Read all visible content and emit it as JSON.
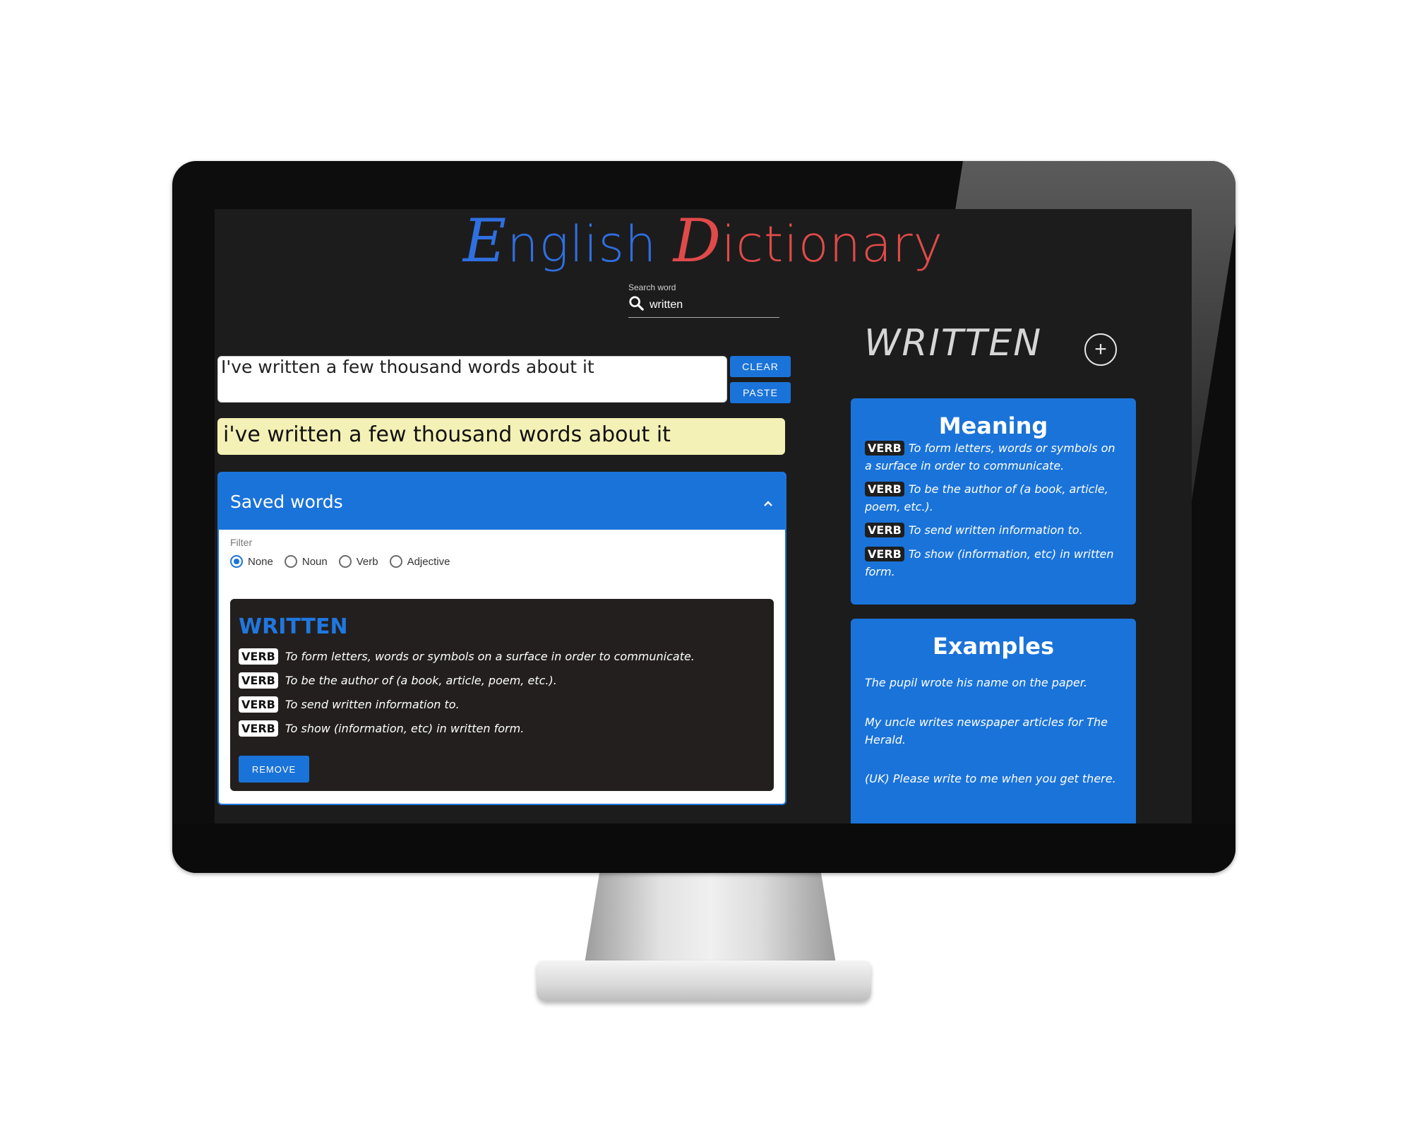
{
  "app": {
    "title_part1_initial": "E",
    "title_part1_rest": "nglish ",
    "title_part2_initial": "D",
    "title_part2_rest": "ictionary",
    "accent_blue": "#1a73d9",
    "accent_red": "#e04a4a"
  },
  "search": {
    "label": "Search word",
    "value": "written",
    "icon": "search-icon"
  },
  "sentence": {
    "value": "I've written a few thousand words about it",
    "clear_label": "CLEAR",
    "paste_label": "PASTE"
  },
  "output": {
    "text": "i've written a few thousand words about it"
  },
  "saved": {
    "header": "Saved words",
    "expand_icon": "chevron-up-icon",
    "filter_label": "Filter",
    "filters": [
      "None",
      "Noun",
      "Verb",
      "Adjective"
    ],
    "selected_filter": "None",
    "card": {
      "word": "WRITTEN",
      "definitions": [
        {
          "pos": "VERB",
          "text": "To form letters, words or symbols on a surface in order to communicate."
        },
        {
          "pos": "VERB",
          "text": "To be the author of (a book, article, poem, etc.)."
        },
        {
          "pos": "VERB",
          "text": "To send written information to."
        },
        {
          "pos": "VERB",
          "text": "To show (information, etc) in written form."
        }
      ],
      "remove_label": "REMOVE"
    }
  },
  "detail": {
    "word": "WRITTEN",
    "add_icon": "plus-circle-icon",
    "meaning_title": "Meaning",
    "meanings": [
      {
        "pos": "VERB",
        "text": "To form letters, words or symbols on a surface in order to communicate."
      },
      {
        "pos": "VERB",
        "text": "To be the author of (a book, article, poem, etc.)."
      },
      {
        "pos": "VERB",
        "text": "To send written information to."
      },
      {
        "pos": "VERB",
        "text": "To show (information, etc) in written form."
      }
    ],
    "examples_title": "Examples",
    "examples": [
      "The pupil wrote his name on the paper.",
      "My uncle writes newspaper articles for The Herald.",
      "(UK) Please write to me when you get there."
    ]
  }
}
